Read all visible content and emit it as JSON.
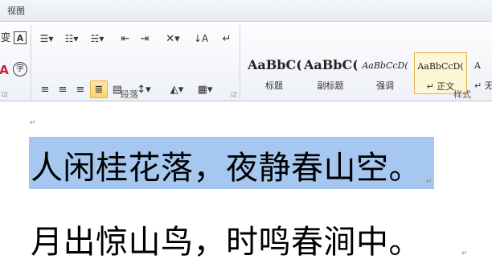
{
  "tab": "视图",
  "ribbon": {
    "paragraph_group_label": "段落",
    "styles_group_label": "样式",
    "styles": [
      {
        "sample": "AaBbC(",
        "name": "标题"
      },
      {
        "sample": "AaBbC(",
        "name": "副标题"
      },
      {
        "sample": "AaBbCcD(",
        "name": "强调"
      },
      {
        "sample": "AaBbCcD(",
        "name": "↵ 正文"
      },
      {
        "sample": "A",
        "name": "↵ 无"
      }
    ]
  },
  "document": {
    "para_mark": "↵",
    "line1": "人闲桂花落，夜静春山空。",
    "line2": "月出惊山鸟，时鸣春涧中。"
  }
}
